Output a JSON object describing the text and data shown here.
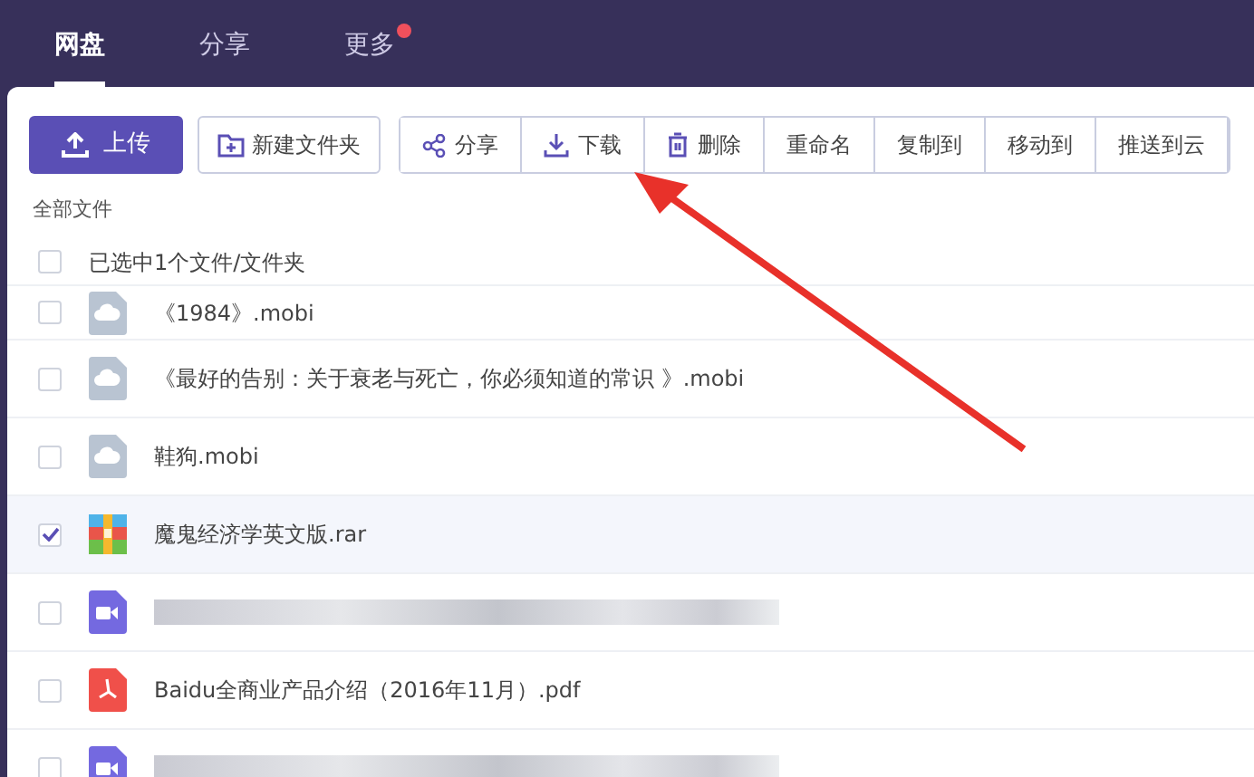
{
  "tabs": [
    {
      "label": "网盘",
      "selected": true,
      "dot": false
    },
    {
      "label": "分享",
      "selected": false,
      "dot": false
    },
    {
      "label": "更多",
      "selected": false,
      "dot": true
    }
  ],
  "toolbar": {
    "primary": {
      "label": "上传"
    },
    "secondary": {
      "label": "新建文件夹"
    },
    "group": [
      {
        "label": "分享"
      },
      {
        "label": "下载"
      },
      {
        "label": "删除"
      },
      {
        "label": "重命名"
      },
      {
        "label": "复制到"
      },
      {
        "label": "移动到"
      },
      {
        "label": "推送到云"
      }
    ]
  },
  "breadcrumb": "全部文件",
  "selection": {
    "label": "已选中1个文件/文件夹",
    "checked": false
  },
  "files": [
    {
      "kind": "ebook",
      "name": "《1984》.mobi",
      "selected": false
    },
    {
      "kind": "ebook",
      "name": "《最好的告别：关于衰老与死亡，你必须知道的常识 》.mobi",
      "selected": false
    },
    {
      "kind": "ebook",
      "name": "鞋狗.mobi",
      "selected": false
    },
    {
      "kind": "rar",
      "name": "魔鬼经济学英文版.rar",
      "selected": true
    },
    {
      "kind": "video",
      "blurred": true,
      "selected": false
    },
    {
      "kind": "pdf",
      "name": "Baidu全商业产品介绍（2016年11月）.pdf",
      "selected": false
    },
    {
      "kind": "video",
      "blurred": true,
      "selected": false
    }
  ],
  "annotation": {
    "arrow": true
  }
}
